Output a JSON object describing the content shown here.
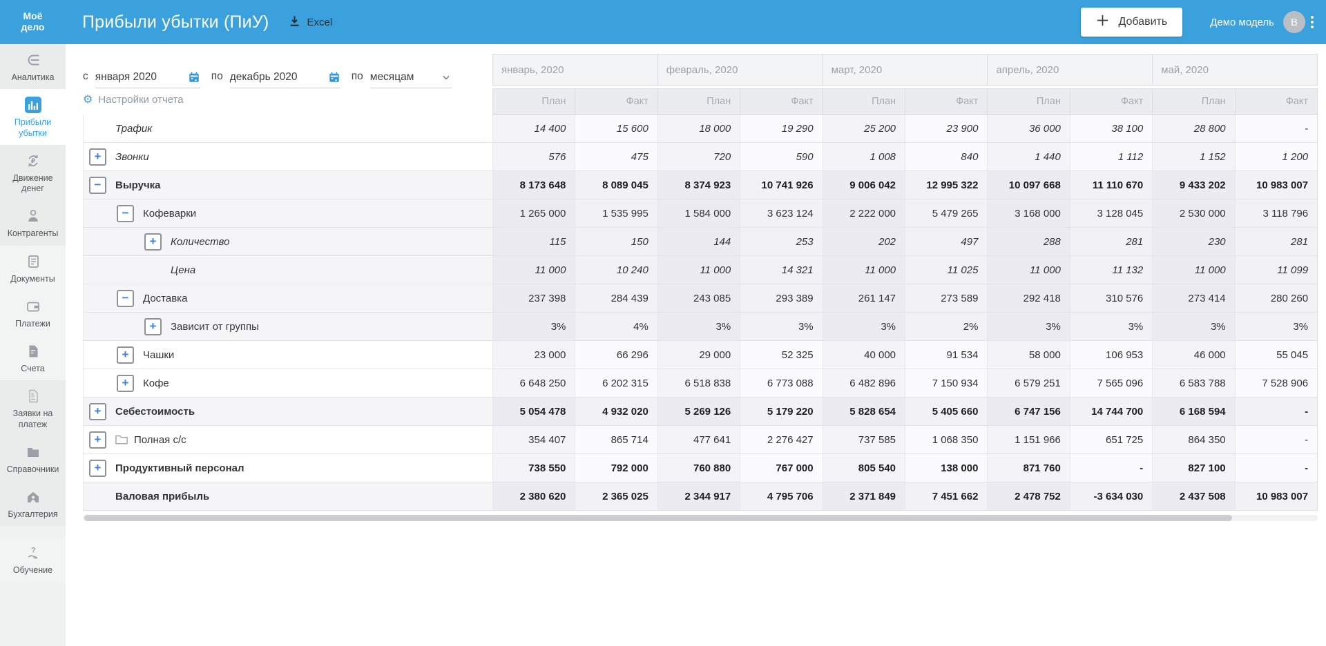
{
  "colors": {
    "accent": "#3ba1dc",
    "header-bg": "#3ba1dc",
    "highlight-row": "#ebebf1",
    "muted-text": "#9ba1a8"
  },
  "header": {
    "logo_line1": "Моё",
    "logo_line2": "дело",
    "title": "Прибыли убытки (ПиУ)",
    "excel_label": "Excel",
    "add_button": "Добавить",
    "account_label": "Демо модель",
    "avatar_letter": "B"
  },
  "sidebar": {
    "items": [
      {
        "id": "analytics",
        "label": "Аналитика",
        "icon": "analytics-icon",
        "active": false,
        "group": 1
      },
      {
        "id": "profit-loss",
        "label": "Прибыли убытки",
        "icon": "bar-chart-icon",
        "active": true,
        "group": 2
      },
      {
        "id": "cash-flow",
        "label": "Движение денег",
        "icon": "money-cycle-icon",
        "active": false,
        "group": 3
      },
      {
        "id": "counterparties",
        "label": "Контрагенты",
        "icon": "person-icon",
        "active": false,
        "group": 3
      },
      {
        "id": "documents",
        "label": "Документы",
        "icon": "document-icon",
        "active": false,
        "group": 4
      },
      {
        "id": "payments",
        "label": "Платежи",
        "icon": "wallet-icon",
        "active": false,
        "group": 4
      },
      {
        "id": "invoices",
        "label": "Счета",
        "icon": "invoice-icon",
        "active": false,
        "group": 4
      },
      {
        "id": "payment-requests",
        "label": "Заявки на платеж",
        "icon": "payment-request-icon",
        "active": false,
        "group": 5
      },
      {
        "id": "directories",
        "label": "Справочники",
        "icon": "folder-icon",
        "active": false,
        "group": 5
      },
      {
        "id": "accounting",
        "label": "Бухгалтерия",
        "icon": "home-icon",
        "active": false,
        "group": 5
      },
      {
        "id": "education",
        "label": "Обучение",
        "icon": "question-hand-icon",
        "active": false,
        "group": 6
      }
    ]
  },
  "filters": {
    "from_label": "с",
    "from_value": "января 2020",
    "to_label": "по",
    "to_value": "декабрь 2020",
    "period_label": "по",
    "period_value": "месяцам",
    "settings_label": "Настройки отчета"
  },
  "table": {
    "months": [
      "январь, 2020",
      "февраль, 2020",
      "март, 2020",
      "апрель, 2020",
      "май, 2020"
    ],
    "subheaders": [
      "План",
      "Факт"
    ],
    "rows": [
      {
        "label": "Трафик",
        "level": 0,
        "toggle": null,
        "emphasis": "italic",
        "highlight": false,
        "folder": false,
        "values": [
          "14 400",
          "15 600",
          "18 000",
          "19 290",
          "25 200",
          "23 900",
          "36 000",
          "38 100",
          "28 800",
          "-"
        ]
      },
      {
        "label": "Звонки",
        "level": 0,
        "toggle": "plus",
        "emphasis": "italic",
        "highlight": false,
        "folder": false,
        "values": [
          "576",
          "475",
          "720",
          "590",
          "1 008",
          "840",
          "1 440",
          "1 112",
          "1 152",
          "1 200"
        ]
      },
      {
        "label": "Выручка",
        "level": 0,
        "toggle": "minus",
        "emphasis": "bold",
        "highlight": true,
        "folder": false,
        "values": [
          "8 173 648",
          "8 089 045",
          "8 374 923",
          "10 741 926",
          "9 006 042",
          "12 995 322",
          "10 097 668",
          "11 110 670",
          "9 433 202",
          "10 983 007"
        ]
      },
      {
        "label": "Кофеварки",
        "level": 1,
        "toggle": "minus",
        "emphasis": "normal",
        "highlight": true,
        "folder": false,
        "values": [
          "1 265 000",
          "1 535 995",
          "1 584 000",
          "3 623 124",
          "2 222 000",
          "5 479 265",
          "3 168 000",
          "3 128 045",
          "2 530 000",
          "3 118 796"
        ]
      },
      {
        "label": "Количество",
        "level": 2,
        "toggle": "plus",
        "emphasis": "italic",
        "highlight": true,
        "folder": false,
        "values": [
          "115",
          "150",
          "144",
          "253",
          "202",
          "497",
          "288",
          "281",
          "230",
          "281"
        ]
      },
      {
        "label": "Цена",
        "level": 2,
        "toggle": null,
        "emphasis": "italic",
        "highlight": true,
        "folder": false,
        "values": [
          "11 000",
          "10 240",
          "11 000",
          "14 321",
          "11 000",
          "11 025",
          "11 000",
          "11 132",
          "11 000",
          "11 099"
        ]
      },
      {
        "label": "Доставка",
        "level": 1,
        "toggle": "minus",
        "emphasis": "normal",
        "highlight": true,
        "folder": false,
        "values": [
          "237 398",
          "284 439",
          "243 085",
          "293 389",
          "261 147",
          "273 589",
          "292 418",
          "310 576",
          "273 414",
          "280 260"
        ]
      },
      {
        "label": "Зависит от группы",
        "level": 2,
        "toggle": "plus",
        "emphasis": "normal",
        "highlight": true,
        "folder": false,
        "values": [
          "3%",
          "4%",
          "3%",
          "3%",
          "3%",
          "2%",
          "3%",
          "3%",
          "3%",
          "3%"
        ]
      },
      {
        "label": "Чашки",
        "level": 1,
        "toggle": "plus",
        "emphasis": "normal",
        "highlight": false,
        "folder": false,
        "values": [
          "23 000",
          "66 296",
          "29 000",
          "52 325",
          "40 000",
          "91 534",
          "58 000",
          "106 953",
          "46 000",
          "55 045"
        ]
      },
      {
        "label": "Кофе",
        "level": 1,
        "toggle": "plus",
        "emphasis": "normal",
        "highlight": false,
        "folder": false,
        "values": [
          "6 648 250",
          "6 202 315",
          "6 518 838",
          "6 773 088",
          "6 482 896",
          "7 150 934",
          "6 579 251",
          "7 565 096",
          "6 583 788",
          "7 528 906"
        ]
      },
      {
        "label": "Себестоимость",
        "level": 0,
        "toggle": "plus",
        "emphasis": "bold",
        "highlight": true,
        "folder": false,
        "values": [
          "5 054 478",
          "4 932 020",
          "5 269 126",
          "5 179 220",
          "5 828 654",
          "5 405 660",
          "6 747 156",
          "14 744 700",
          "6 168 594",
          "-"
        ]
      },
      {
        "label": "Полная с/с",
        "level": 0,
        "toggle": "plus",
        "emphasis": "normal",
        "highlight": false,
        "folder": true,
        "values": [
          "354 407",
          "865 714",
          "477 641",
          "2 276 427",
          "737 585",
          "1 068 350",
          "1 151 966",
          "651 725",
          "864 350",
          "-"
        ]
      },
      {
        "label": "Продуктивный персонал",
        "level": 0,
        "toggle": "plus",
        "emphasis": "bold",
        "highlight": false,
        "folder": false,
        "values": [
          "738 550",
          "792 000",
          "760 880",
          "767 000",
          "805 540",
          "138 000",
          "871 760",
          "-",
          "827 100",
          "-"
        ]
      },
      {
        "label": "Валовая прибыль",
        "level": 0,
        "toggle": null,
        "emphasis": "bold",
        "highlight": true,
        "folder": false,
        "values": [
          "2 380 620",
          "2 365 025",
          "2 344 917",
          "4 795 706",
          "2 371 849",
          "7 451 662",
          "2 478 752",
          "-3 634 030",
          "2 437 508",
          "10 983 007"
        ]
      }
    ]
  }
}
